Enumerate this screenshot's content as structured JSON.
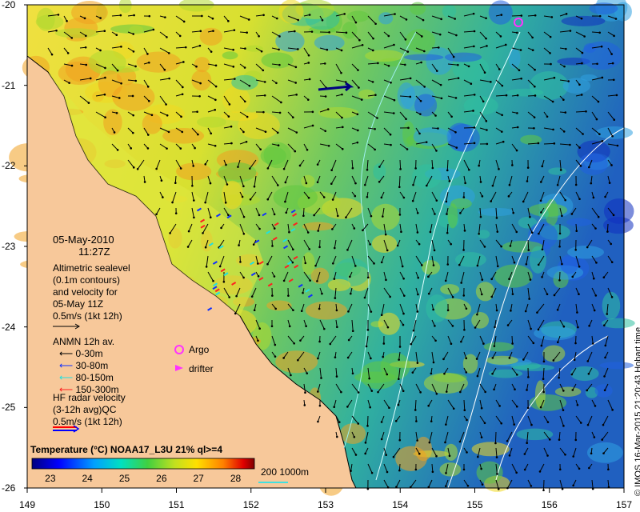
{
  "map": {
    "date": "05-May-2010",
    "time": "11:27Z",
    "altimetry_legend": [
      "Altimetric sealevel",
      "(0.1m contours)",
      "and velocity for",
      "05-May 11Z",
      "0.5m/s (1kt 12h)"
    ],
    "anmn_title": "ANMN 12h av.",
    "anmn_depths": [
      "0-30m",
      "30-80m",
      "80-150m",
      "150-300m"
    ],
    "anmn_colors": [
      "#000000",
      "#1030ff",
      "#20e0e0",
      "#ff2020"
    ],
    "argo_label": "Argo",
    "drifter_label": "drifter",
    "argo_color": "#ff33ff",
    "hf_radar_legend": [
      "HF radar velocity",
      "(3-12h avg)QC",
      "0.5m/s (1kt 12h)"
    ],
    "colorbar_title": "Temperature (°C) NOAA17_L3U 21% ql>=4",
    "colorbar_ticks": [
      "23",
      "24",
      "25",
      "26",
      "27",
      "28"
    ],
    "colorbar_range": [
      22.5,
      28.5
    ],
    "isobath_label": "200  1000m",
    "credit": "© IMOS 16-Mar-2015 21:20:43 Hobart time",
    "lon_ticks": [
      "149",
      "150",
      "151",
      "152",
      "153",
      "154",
      "155",
      "156",
      "157"
    ],
    "lat_ticks": [
      "-20",
      "-21",
      "-22",
      "-23",
      "-24",
      "-25",
      "-26"
    ],
    "lon_range": [
      149,
      157
    ],
    "lat_range": [
      -26,
      -20
    ],
    "land_color": "#f7c89a",
    "icons": [
      "argo-float-icon",
      "drifter-icon",
      "velocity-arrow-icon"
    ]
  }
}
